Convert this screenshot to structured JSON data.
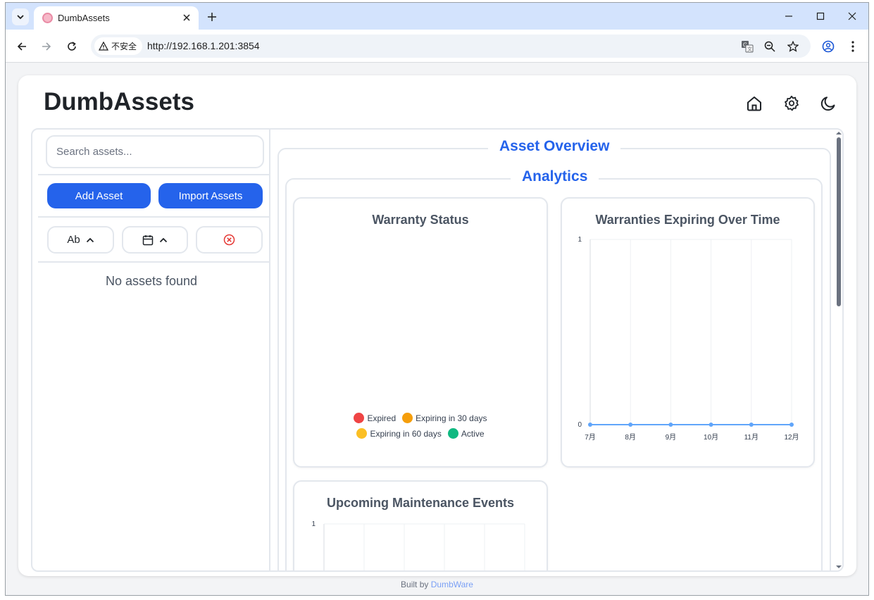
{
  "browser": {
    "tab_title": "DumbAssets",
    "security_label": "不安全",
    "url": "http://192.168.1.201:3854"
  },
  "app": {
    "title": "DumbAssets",
    "header_icons": [
      "home-icon",
      "settings-icon",
      "dark-mode-icon"
    ]
  },
  "sidebar": {
    "search_placeholder": "Search assets...",
    "add_asset_label": "Add Asset",
    "import_assets_label": "Import Assets",
    "sort_name_label": "Ab",
    "empty_message": "No assets found"
  },
  "main": {
    "overview_title": "Asset Overview",
    "analytics_title": "Analytics"
  },
  "chart_data": [
    {
      "type": "pie",
      "title": "Warranty Status",
      "categories": [
        "Expired",
        "Expiring in 30 days",
        "Expiring in 60 days",
        "Active"
      ],
      "values": [
        0,
        0,
        0,
        0
      ],
      "colors": [
        "#ef4444",
        "#f59e0b",
        "#fbbf24",
        "#10b981"
      ],
      "legend": "bottom"
    },
    {
      "type": "line",
      "title": "Warranties Expiring Over Time",
      "categories": [
        "7月",
        "8月",
        "9月",
        "10月",
        "11月",
        "12月"
      ],
      "values": [
        0,
        0,
        0,
        0,
        0,
        0
      ],
      "ylim": [
        0,
        1
      ],
      "yticks": [
        "0",
        "1"
      ],
      "color": "#60a5fa",
      "grid": true
    },
    {
      "type": "line",
      "title": "Upcoming Maintenance Events",
      "categories": [],
      "values": [],
      "ylim": [
        0,
        1
      ],
      "yticks": [
        "1"
      ],
      "grid": true
    }
  ],
  "footer": {
    "prefix": "Built by",
    "link": "DumbWare"
  },
  "colors": {
    "accent": "#2563eb",
    "border": "#e3e7ed",
    "page_bg": "#f3f4f6"
  }
}
